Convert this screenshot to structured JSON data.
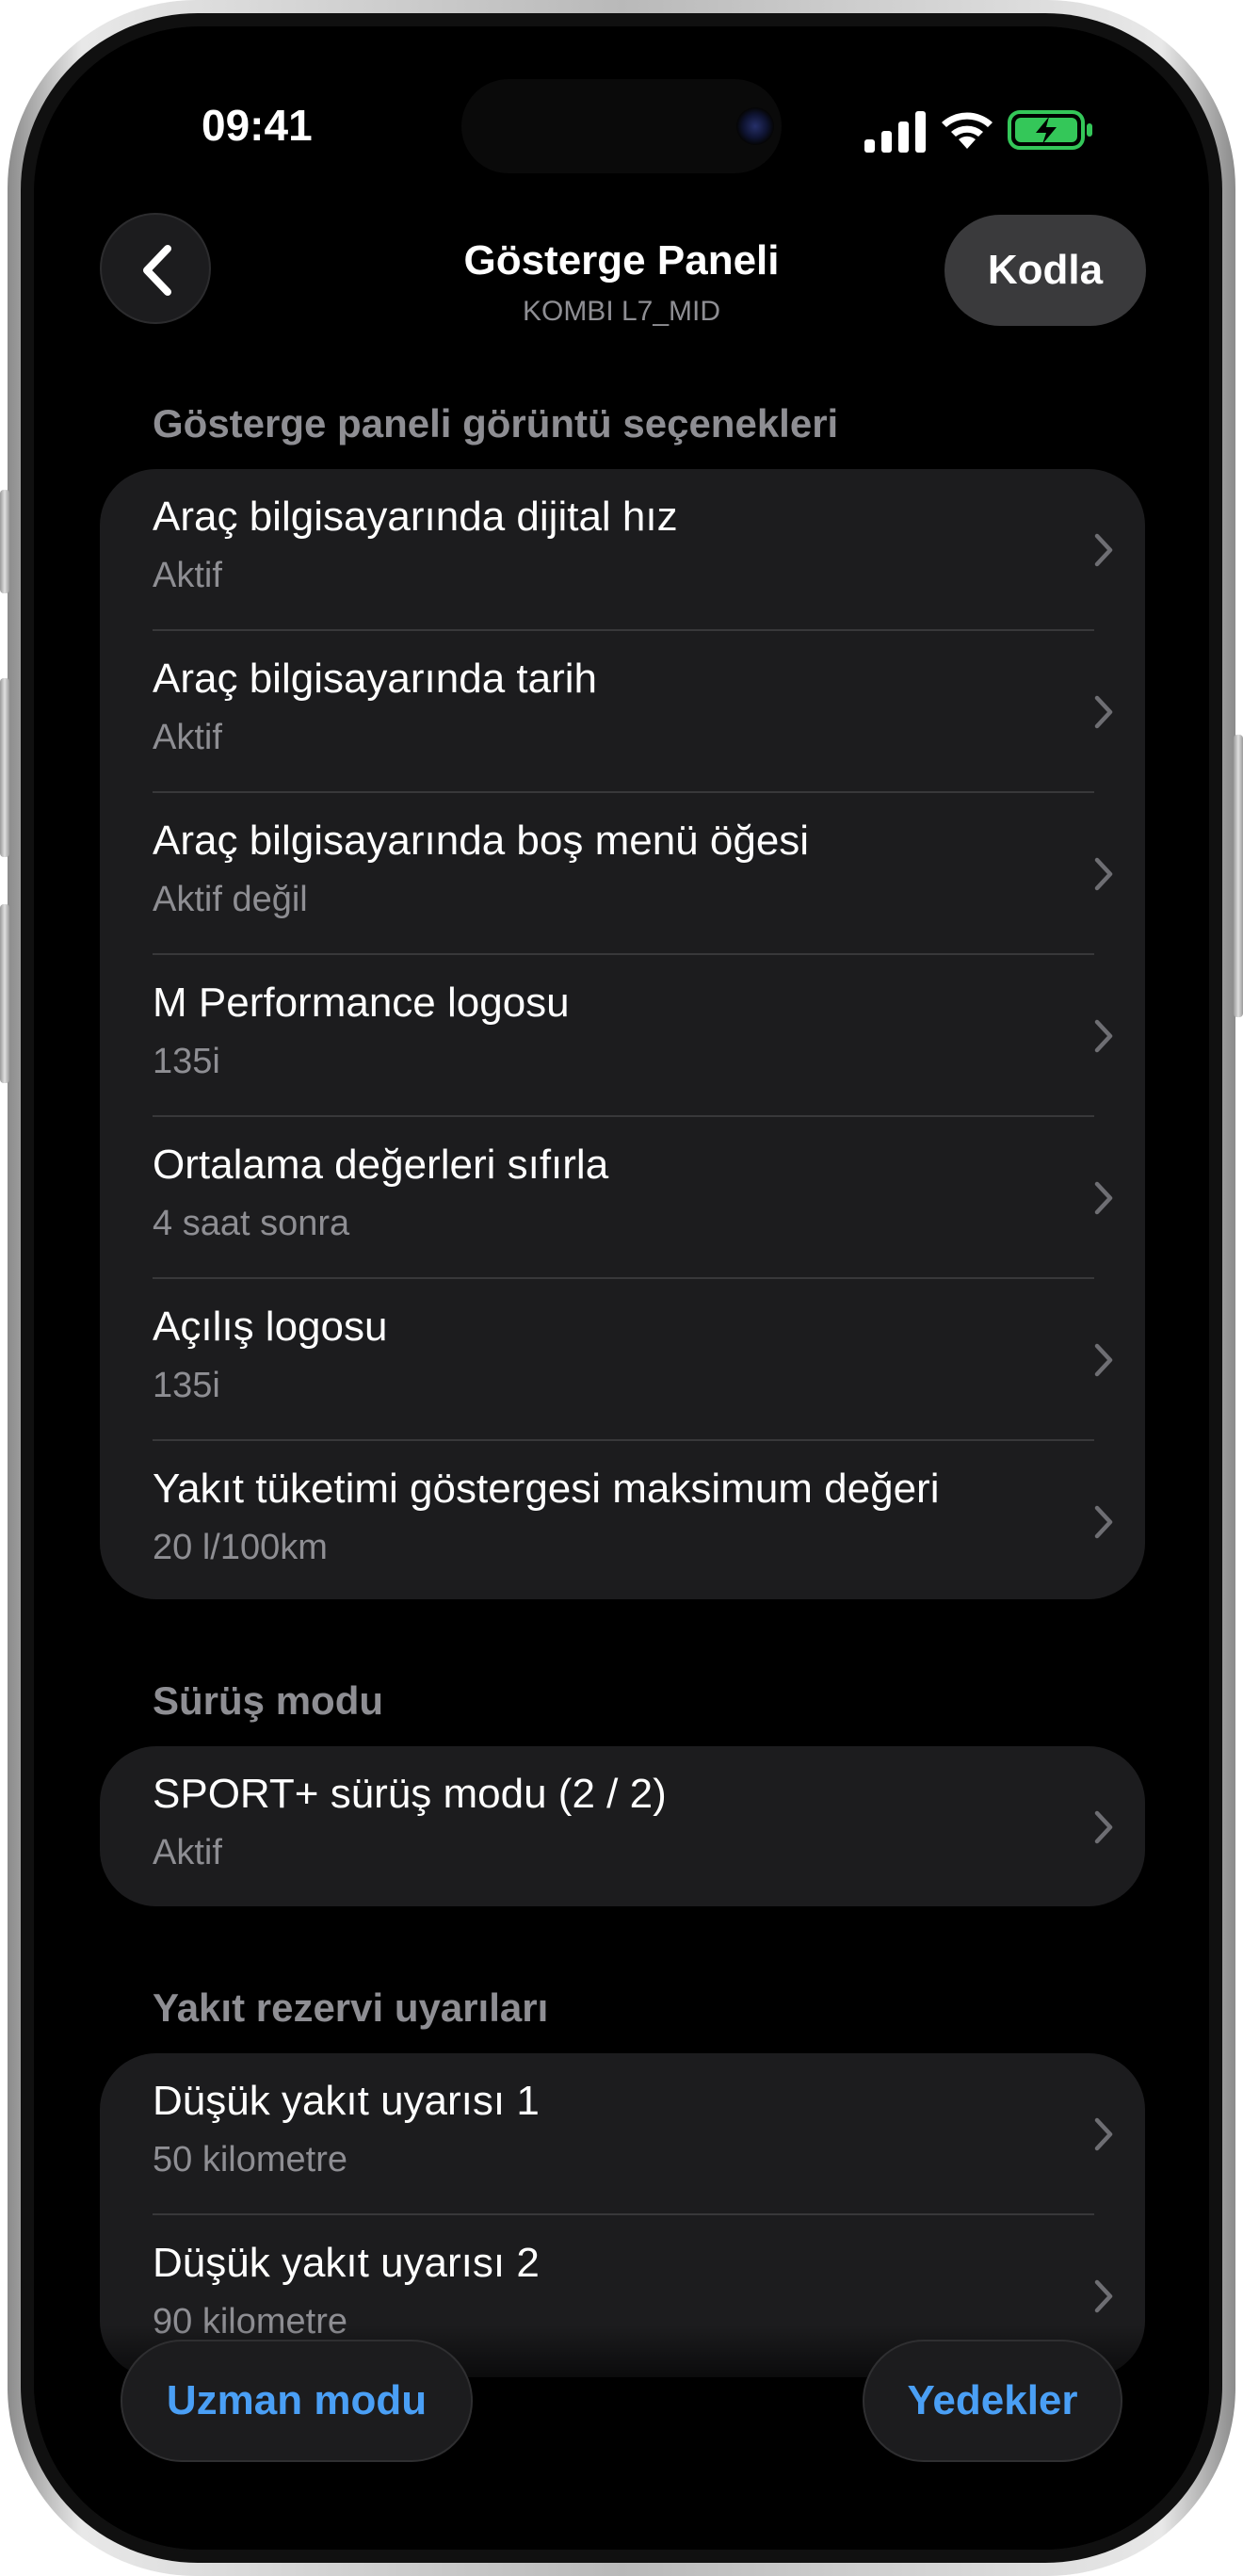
{
  "status_bar": {
    "time": "09:41"
  },
  "nav": {
    "title": "Gösterge Paneli",
    "subtitle": "KOMBI L7_MID",
    "action_label": "Kodla"
  },
  "sections": [
    {
      "title": "Gösterge paneli görüntü seçenekleri",
      "rows": [
        {
          "title": "Araç bilgisayarında dijital hız",
          "value": "Aktif"
        },
        {
          "title": "Araç bilgisayarında tarih",
          "value": "Aktif"
        },
        {
          "title": "Araç bilgisayarında boş menü öğesi",
          "value": "Aktif değil"
        },
        {
          "title": "M Performance logosu",
          "value": "135i"
        },
        {
          "title": "Ortalama değerleri sıfırla",
          "value": "4 saat sonra"
        },
        {
          "title": "Açılış logosu",
          "value": "135i"
        },
        {
          "title": "Yakıt tüketimi göstergesi maksimum değeri",
          "value": "20 l/100km"
        }
      ]
    },
    {
      "title": "Sürüş modu",
      "rows": [
        {
          "title": "SPORT+ sürüş modu (2 / 2)",
          "value": "Aktif"
        }
      ]
    },
    {
      "title": "Yakıt rezervi uyarıları",
      "rows": [
        {
          "title": "Düşük yakıt uyarısı 1",
          "value": "50 kilometre"
        },
        {
          "title": "Düşük yakıt uyarısı 2",
          "value": "90 kilometre"
        }
      ]
    }
  ],
  "bottom": {
    "expert_label": "Uzman modu",
    "backups_label": "Yedekler"
  },
  "colors": {
    "background": "#000000",
    "card": "#1c1c1e",
    "accent_blue": "#4a9ff5",
    "secondary_text": "#8e8e93",
    "battery_green": "#34c759"
  }
}
